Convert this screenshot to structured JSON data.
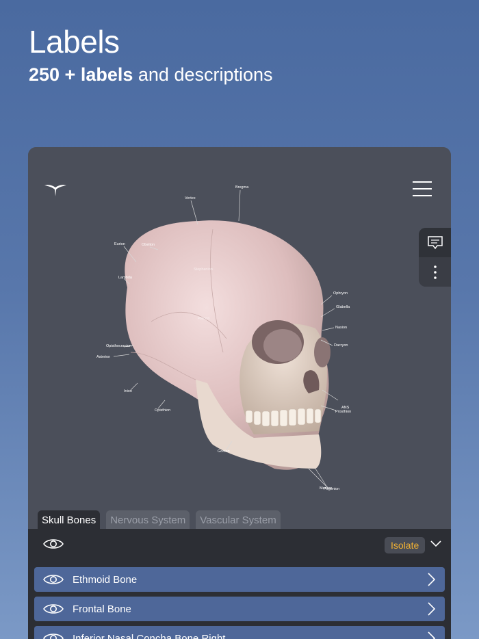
{
  "header": {
    "title": "Labels",
    "subtitle_strong": "250 + labels",
    "subtitle_rest": "and descriptions"
  },
  "skull_labels": [
    "Bregma",
    "Vertex",
    "Eurion",
    "Obelion",
    "Lambda",
    "Ophryon",
    "Glabella",
    "Nasion",
    "Dacryon",
    "Opisthocranion",
    "Asterion",
    "Inion",
    "Opisthion",
    "ANS",
    "Prosthion",
    "Gonion",
    "Menton",
    "Pogonion",
    "Stephanion",
    "Pterion"
  ],
  "tabs": [
    {
      "label": "Skull Bones",
      "active": true
    },
    {
      "label": "Nervous System",
      "active": false
    },
    {
      "label": "Vascular System",
      "active": false
    }
  ],
  "controls": {
    "isolate_label": "Isolate"
  },
  "list": {
    "items": [
      {
        "name": "Ethmoid Bone"
      },
      {
        "name": "Frontal Bone"
      },
      {
        "name": "Inferior Nasal Concha Bone Right"
      }
    ]
  },
  "icons": {
    "logo": "brand-logo-icon",
    "menu": "hamburger-menu-icon",
    "comment": "comment-icon",
    "more": "more-vertical-icon",
    "eye": "eye-icon",
    "chevron_right": "chevron-right-icon",
    "chevron_down": "chevron-down-icon"
  },
  "colors": {
    "background_top": "#4a6aa0",
    "panel": "#4b4f5a",
    "list_item": "#4e6799",
    "isolate_text": "#f2b233"
  }
}
